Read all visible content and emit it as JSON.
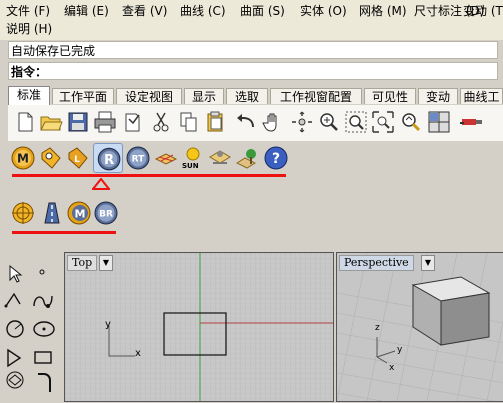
{
  "menu": {
    "items": [
      "文件 (F)",
      "编辑 (E)",
      "查看 (V)",
      "曲线 (C)",
      "曲面 (S)",
      "实体 (O)",
      "网格 (M)",
      "尺寸标注 (D)",
      "变动 (T)",
      "说明 (H)"
    ]
  },
  "status": {
    "text": "自动保存已完成"
  },
  "command": {
    "label": "指令："
  },
  "tabs": [
    "标准",
    "工作平面",
    "设定视图",
    "显示",
    "选取",
    "工作视窗配置",
    "可见性",
    "变动",
    "曲线工"
  ],
  "toolbar1": {
    "icons": [
      "new-document-icon",
      "open-folder-icon",
      "save-disk-icon",
      "print-icon",
      "document-props-icon",
      "cut-icon",
      "copy-icon",
      "paste-icon",
      "undo-icon",
      "pan-hand-icon",
      "rotate-view-icon",
      "zoom-window-icon",
      "zoom-extents-icon",
      "zoom-selected-icon",
      "zoom-all-icon",
      "four-view-icon",
      "grid-tool-icon"
    ]
  },
  "toolbar2": {
    "buttons": [
      "M",
      "",
      "",
      "R",
      "RT",
      "",
      "SUN",
      "",
      "",
      ""
    ],
    "sun_label": "SUN"
  },
  "toolbar3": {
    "buttons": [
      "",
      "",
      "M",
      "BR"
    ]
  },
  "viewports": {
    "top_title": "Top",
    "persp_title": "Perspective",
    "axis_x": "x",
    "axis_y": "y",
    "axis_z": "z"
  },
  "colors": {
    "accent_red": "#e11111",
    "grid_line": "#b5b5b5",
    "viewport_bg": "#c8c8c8",
    "x_axis": "#b04040",
    "y_axis": "#40a040"
  }
}
